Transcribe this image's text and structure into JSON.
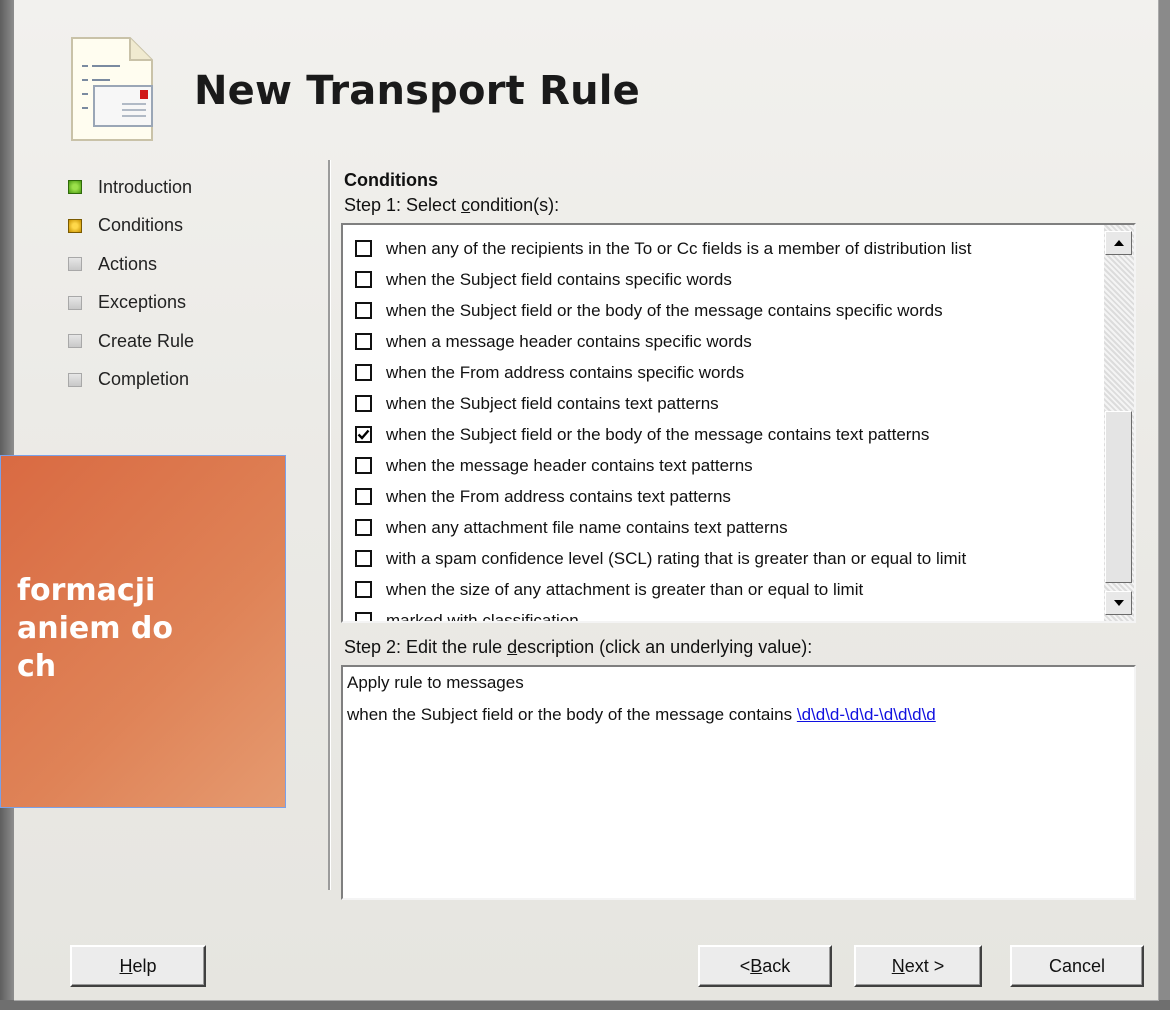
{
  "header": {
    "title": "New Transport Rule"
  },
  "sidebar": {
    "steps": [
      {
        "label": "Introduction",
        "state": "done",
        "color": "#4a9a12"
      },
      {
        "label": "Conditions",
        "state": "current",
        "color": "#c79000"
      },
      {
        "label": "Actions",
        "state": "pending",
        "color": "#c8c8c8"
      },
      {
        "label": "Exceptions",
        "state": "pending",
        "color": "#c8c8c8"
      },
      {
        "label": "Create Rule",
        "state": "pending",
        "color": "#c8c8c8"
      },
      {
        "label": "Completion",
        "state": "pending",
        "color": "#c8c8c8"
      }
    ]
  },
  "conditions": {
    "section_title": "Conditions",
    "step1_prefix": "Step 1: Select ",
    "step1_accel": "c",
    "step1_suffix": "ondition(s):",
    "items": [
      {
        "label": "when any of the recipients in the To or Cc fields is a member of distribution list",
        "checked": false
      },
      {
        "label": "when the Subject field contains specific words",
        "checked": false
      },
      {
        "label": "when the Subject field or the body of the message contains specific words",
        "checked": false
      },
      {
        "label": "when a message header contains specific words",
        "checked": false
      },
      {
        "label": "when the From address contains specific words",
        "checked": false
      },
      {
        "label": "when the Subject field contains text patterns",
        "checked": false
      },
      {
        "label": "when the Subject field or the body of the message contains text patterns",
        "checked": true
      },
      {
        "label": "when the message header contains text patterns",
        "checked": false
      },
      {
        "label": "when the From address contains text patterns",
        "checked": false
      },
      {
        "label": "when any attachment file name contains text patterns",
        "checked": false
      },
      {
        "label": "with a spam confidence level (SCL) rating that is greater than or equal to limit",
        "checked": false
      },
      {
        "label": "when the size of any attachment is greater than or equal to limit",
        "checked": false
      },
      {
        "label": "marked with classification",
        "checked": false
      }
    ]
  },
  "description": {
    "step2_prefix": "Step 2: Edit the rule ",
    "step2_accel": "d",
    "step2_suffix": "escription (click an underlying value):",
    "line1": "Apply rule to messages",
    "line2_prefix": "when the Subject field or the body of the message contains ",
    "line2_link": "\\d\\d\\d-\\d\\d-\\d\\d\\d\\d"
  },
  "buttons": {
    "help_accel": "H",
    "help_rest": "elp",
    "back_pre": "< ",
    "back_accel": "B",
    "back_rest": "ack",
    "next_accel": "N",
    "next_rest": "ext >",
    "cancel": "Cancel"
  },
  "overlay": {
    "lines": [
      "formacji",
      "aniem do",
      "ch"
    ],
    "color": "#df8357"
  }
}
